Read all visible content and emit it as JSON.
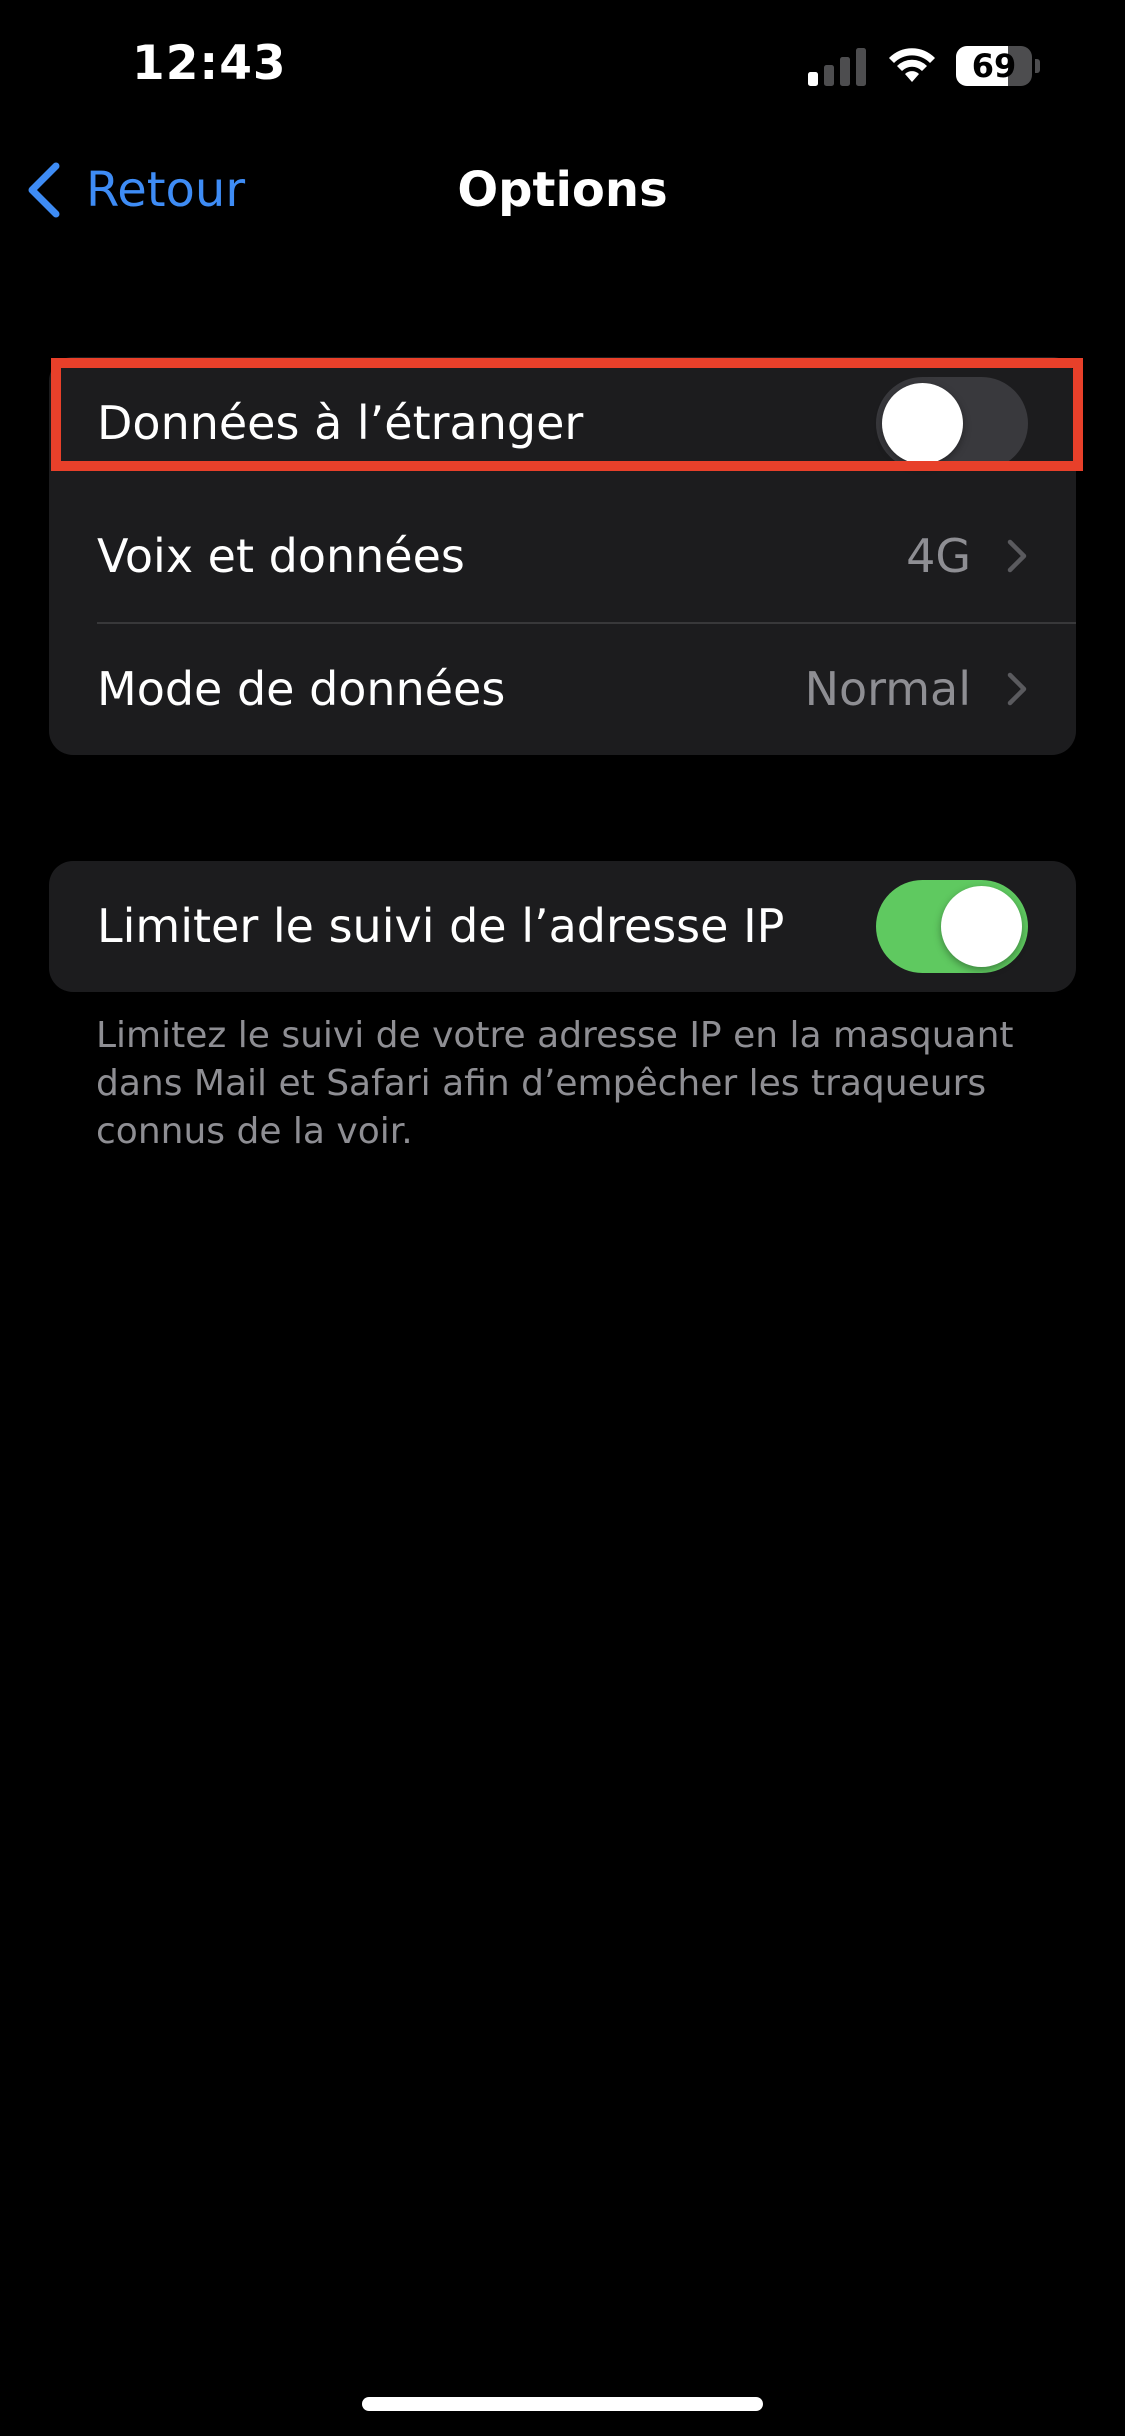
{
  "status_bar": {
    "time": "12:43",
    "battery_percent": "69",
    "battery_level": 0.69,
    "signal_bars_active": 1,
    "signal_bars_total": 4,
    "icons": [
      "cellular-signal-icon",
      "wifi-icon",
      "battery-icon"
    ]
  },
  "nav": {
    "back_label": "Retour",
    "title": "Options",
    "back_icon": "chevron-left-icon",
    "accent_color": "#3e8cf5"
  },
  "group1": {
    "rows": [
      {
        "label": "Données à l’étranger",
        "type": "toggle",
        "on": false
      },
      {
        "label": "Voix et données",
        "type": "disclosure",
        "value": "4G"
      },
      {
        "label": "Mode de données",
        "type": "disclosure",
        "value": "Normal"
      }
    ],
    "highlight_color": "#e8402a"
  },
  "group2": {
    "rows": [
      {
        "label": "Limiter le suivi de l’adresse IP",
        "type": "toggle",
        "on": true
      }
    ],
    "footer": "Limitez le suivi de votre adresse IP en la masquant dans Mail et Safari afin d’empêcher les traqueurs connus de la voir."
  },
  "colors": {
    "toggle_on": "#5fc960",
    "toggle_off": "#39393d",
    "group_background": "#1c1c1e",
    "secondary_text": "#8e8e93"
  }
}
